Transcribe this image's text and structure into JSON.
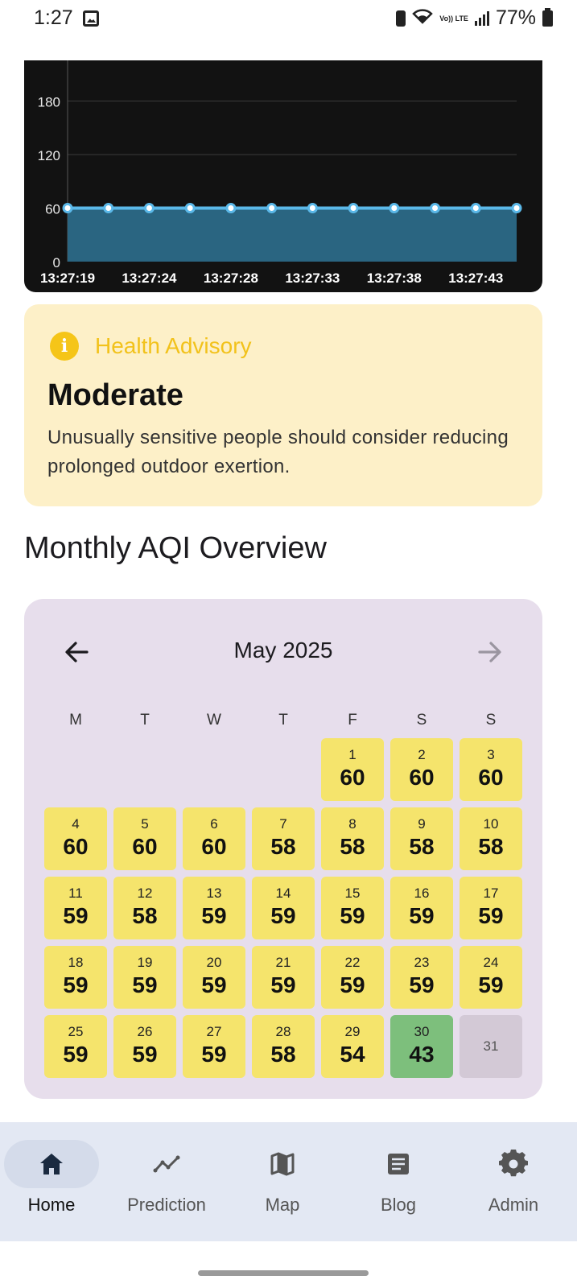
{
  "status_bar": {
    "time": "1:27",
    "battery_pct": "77%",
    "volte": "Vo)) LTE"
  },
  "chart_data": {
    "type": "area",
    "x": [
      "13:27:19",
      "13:27:21.5",
      "13:27:24",
      "13:27:26",
      "13:27:28",
      "13:27:30.5",
      "13:27:33",
      "13:27:35.5",
      "13:27:38",
      "13:27:40.5",
      "13:27:43",
      "13:27:45.5"
    ],
    "x_tick_labels": [
      "13:27:19",
      "13:27:24",
      "13:27:28",
      "13:27:33",
      "13:27:38",
      "13:27:43"
    ],
    "series": [
      {
        "values": [
          60,
          60,
          60,
          60,
          60,
          60,
          60,
          60,
          60,
          60,
          60,
          60
        ]
      }
    ],
    "y_ticks": [
      0,
      60,
      120,
      180
    ],
    "ylim": [
      0,
      200
    ],
    "grid": true,
    "line_color": "#5bb8e8",
    "fill_color": "#2a6581",
    "background": "#121212"
  },
  "advisory": {
    "heading": "Health Advisory",
    "icon": "info-icon",
    "level": "Moderate",
    "message": "Unusually sensitive people should consider reducing prolonged outdoor exertion.",
    "accent_color": "#f2c21b"
  },
  "section_title": "Monthly AQI Overview",
  "calendar": {
    "month_label": "May 2025",
    "prev_icon": "arrow-left-icon",
    "next_icon": "arrow-right-icon",
    "weekdays": [
      "M",
      "T",
      "W",
      "T",
      "F",
      "S",
      "S"
    ],
    "start_offset": 4,
    "days": [
      {
        "d": "1",
        "v": "60"
      },
      {
        "d": "2",
        "v": "60"
      },
      {
        "d": "3",
        "v": "60"
      },
      {
        "d": "4",
        "v": "60"
      },
      {
        "d": "5",
        "v": "60"
      },
      {
        "d": "6",
        "v": "60"
      },
      {
        "d": "7",
        "v": "58"
      },
      {
        "d": "8",
        "v": "58"
      },
      {
        "d": "9",
        "v": "58"
      },
      {
        "d": "10",
        "v": "58"
      },
      {
        "d": "11",
        "v": "59"
      },
      {
        "d": "12",
        "v": "58"
      },
      {
        "d": "13",
        "v": "59"
      },
      {
        "d": "14",
        "v": "59"
      },
      {
        "d": "15",
        "v": "59"
      },
      {
        "d": "16",
        "v": "59"
      },
      {
        "d": "17",
        "v": "59"
      },
      {
        "d": "18",
        "v": "59"
      },
      {
        "d": "19",
        "v": "59"
      },
      {
        "d": "20",
        "v": "59"
      },
      {
        "d": "21",
        "v": "59"
      },
      {
        "d": "22",
        "v": "59"
      },
      {
        "d": "23",
        "v": "59"
      },
      {
        "d": "24",
        "v": "59"
      },
      {
        "d": "25",
        "v": "59"
      },
      {
        "d": "26",
        "v": "59"
      },
      {
        "d": "27",
        "v": "59"
      },
      {
        "d": "28",
        "v": "58"
      },
      {
        "d": "29",
        "v": "54"
      },
      {
        "d": "30",
        "v": "43",
        "status": "good"
      },
      {
        "d": "31",
        "v": "",
        "status": "empty"
      }
    ],
    "colors": {
      "moderate": "#f5e46c",
      "good": "#7dbf7c",
      "empty": "#d3c9d6"
    }
  },
  "nav": {
    "items": [
      {
        "label": "Home",
        "icon": "home-icon",
        "active": true
      },
      {
        "label": "Prediction",
        "icon": "trend-line-icon",
        "active": false
      },
      {
        "label": "Map",
        "icon": "map-icon",
        "active": false
      },
      {
        "label": "Blog",
        "icon": "article-icon",
        "active": false
      },
      {
        "label": "Admin",
        "icon": "gear-icon",
        "active": false
      }
    ]
  }
}
